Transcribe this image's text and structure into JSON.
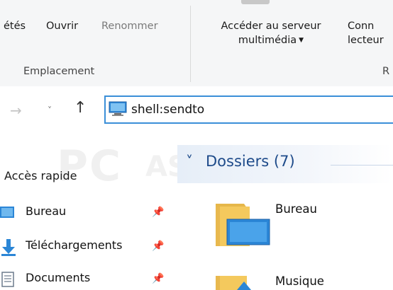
{
  "ribbon": {
    "buttons": {
      "proprietes": "étés",
      "ouvrir": "Ouvrir",
      "renommer": "Renommer",
      "acceder_line1": "Accéder au serveur",
      "acceder_line2": "multimédia",
      "conn_line1": "Conn",
      "conn_line2": "lecteur"
    },
    "groups": {
      "emplacement": "Emplacement",
      "reseau_initial": "R"
    }
  },
  "address_bar": {
    "value": "shell:sendto",
    "icon": "this-pc-icon"
  },
  "navigation": {
    "back_icon": "back-arrow-icon",
    "forward_icon": "forward-arrow-icon",
    "recent_icon": "chevron-down-icon",
    "up_icon": "up-arrow-icon"
  },
  "watermark": {
    "text": "PC",
    "text2": "ASTUCES"
  },
  "nav_pane": {
    "quick_access": "Accès rapide",
    "items": [
      {
        "label": "Bureau",
        "icon": "desktop-icon"
      },
      {
        "label": "Téléchargements",
        "icon": "download-icon"
      },
      {
        "label": "Documents",
        "icon": "documents-icon"
      }
    ],
    "pin_icon": "pin-icon"
  },
  "content": {
    "group_title": "Dossiers (7)",
    "items": [
      {
        "label": "Bureau",
        "icon": "desktop-folder-icon"
      },
      {
        "label": "Musique",
        "icon": "music-folder-icon"
      }
    ]
  },
  "colors": {
    "accent": "#3b8fd8",
    "group_header_text": "#1e4b8a",
    "folder": "#f4c95d"
  }
}
